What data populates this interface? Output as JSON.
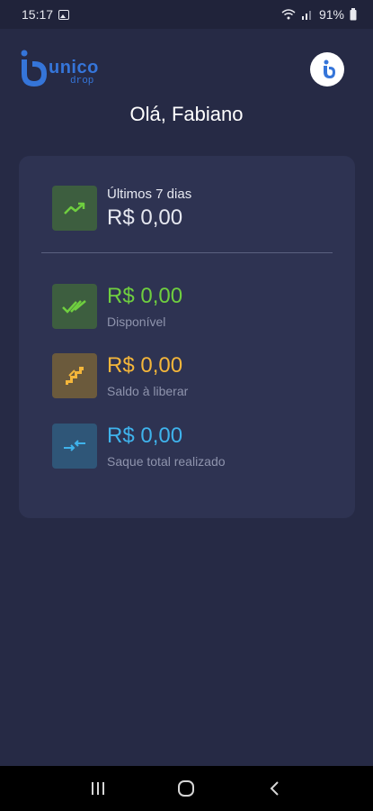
{
  "status_bar": {
    "time": "15:17",
    "battery": "91%"
  },
  "header": {
    "brand": "unico",
    "brand_sub": "drop",
    "greeting": "Olá, Fabiano"
  },
  "summary": {
    "label": "Últimos 7 dias",
    "value": "R$ 0,00",
    "icon": "trending-up-icon"
  },
  "metrics": [
    {
      "value": "R$ 0,00",
      "label": "Disponível",
      "color": "#6fcf3f",
      "icon_bg": "#3d5e3f",
      "icon": "double-check-icon"
    },
    {
      "value": "R$ 0,00",
      "label": "Saldo à liberar",
      "color": "#f4b63a",
      "icon_bg": "#6b5a3c",
      "icon": "stairs-icon"
    },
    {
      "value": "R$ 0,00",
      "label": "Saque total realizado",
      "color": "#3fb3ec",
      "icon_bg": "#2f5678",
      "icon": "transfer-arrows-icon"
    }
  ],
  "colors": {
    "background": "#262a45",
    "card": "#2e3352",
    "summary_icon_bg": "#3d5e3f",
    "summary_icon": "#6fcf3f",
    "brand": "#3575d9"
  }
}
